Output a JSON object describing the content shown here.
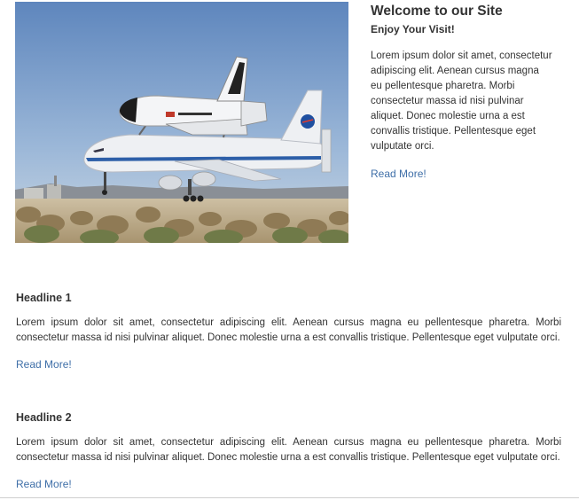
{
  "hero": {
    "image_icon": "space-shuttle-carrier-photo"
  },
  "welcome": {
    "title": "Welcome to our Site",
    "subtitle": "Enjoy Your Visit!",
    "body": "Lorem ipsum dolor sit amet, consectetur adipiscing elit. Aenean cursus magna eu pellentesque pharetra. Morbi consectetur massa id nisi pulvinar aliquet. Donec molestie urna a est convallis tristique. Pellentesque eget vulputate orci.",
    "read_more": "Read More!"
  },
  "articles": [
    {
      "headline": "Headline 1",
      "body": "Lorem ipsum dolor sit amet, consectetur adipiscing elit. Aenean cursus magna eu pellentesque pharetra. Morbi consectetur massa id nisi pulvinar aliquet. Donec molestie urna a est convallis tristique. Pellentesque eget vulputate orci.",
      "read_more": "Read More!"
    },
    {
      "headline": "Headline 2",
      "body": "Lorem ipsum dolor sit amet, consectetur adipiscing elit. Aenean cursus magna eu pellentesque pharetra. Morbi consectetur massa id nisi pulvinar aliquet. Donec molestie urna a est convallis tristique. Pellentesque eget vulputate orci.",
      "read_more": "Read More!"
    }
  ],
  "colors": {
    "link": "#3f6fa8",
    "text": "#333333",
    "sky": "#7fa3cf"
  }
}
